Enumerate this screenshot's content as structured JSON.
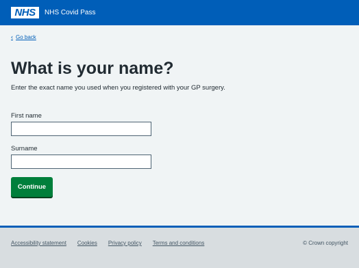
{
  "header": {
    "logo_text": "NHS",
    "service_name": "NHS Covid Pass"
  },
  "back_link": {
    "label": "Go back"
  },
  "main": {
    "title": "What is your name?",
    "hint": "Enter the exact name you used when you registered with your GP surgery.",
    "first_name": {
      "label": "First name",
      "value": ""
    },
    "surname": {
      "label": "Surname",
      "value": ""
    },
    "continue_label": "Continue"
  },
  "footer": {
    "links": [
      "Accessibility statement",
      "Cookies",
      "Privacy policy",
      "Terms and conditions"
    ],
    "copyright": "© Crown copyright"
  },
  "colors": {
    "header_blue": "#005eb8",
    "button_green": "#007f3b",
    "background": "#f0f4f5",
    "footer_bg": "#d8dde0"
  }
}
